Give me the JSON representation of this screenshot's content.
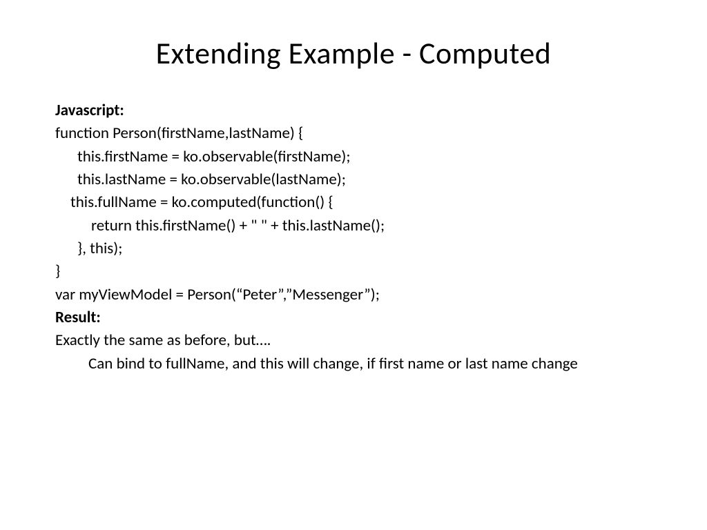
{
  "title": "Extending Example - Computed",
  "lines": {
    "js_label": "Javascript:",
    "l1": "function Person(firstName,lastName) {",
    "l2": "this.firstName = ko.observable(firstName);",
    "l3": "this.lastName = ko.observable(lastName);",
    "l4": "this.fullName = ko.computed(function() {",
    "l5": "return this.firstName() + \" \" + this.lastName();",
    "l6": "}, this);",
    "l7": "}",
    "l8": "var myViewModel = Person(“Peter”,”Messenger”);",
    "result_label": "Result:",
    "r1": "Exactly the same as before, but….",
    "r2": "Can bind to fullName, and this will change, if first name or last name change"
  }
}
